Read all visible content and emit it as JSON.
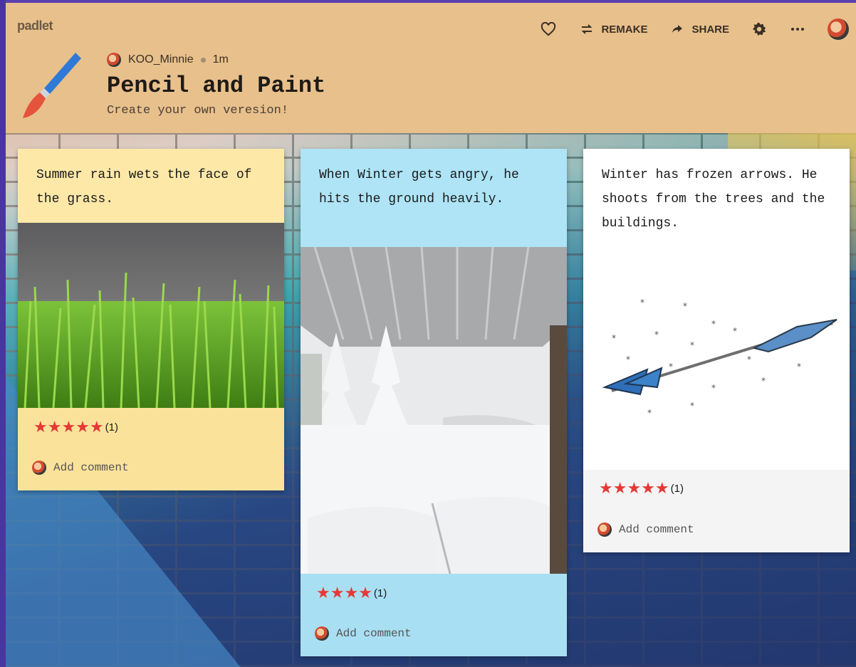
{
  "app": {
    "name": "padlet"
  },
  "toolbar": {
    "remake_label": "REMAKE",
    "share_label": "SHARE"
  },
  "board": {
    "author": "KOO_Minnie",
    "time": "1m",
    "title": "Pencil and Paint",
    "subtitle": "Create your own veresion!"
  },
  "posts": [
    {
      "text": "Summer rain wets the face of the grass.",
      "stars": "★★★★★",
      "rating_count": "(1)",
      "comment_label": "Add comment"
    },
    {
      "text": "When Winter gets angry, he hits the ground heavily.",
      "stars": "★★★★",
      "rating_count": "(1)",
      "comment_label": "Add comment"
    },
    {
      "text": "Winter has frozen arrows. He shoots from the trees and the buildings.",
      "stars": "★★★★★",
      "rating_count": "(1)",
      "comment_label": "Add comment"
    }
  ],
  "icons": [
    "heart-icon",
    "remake-icon",
    "share-icon",
    "gear-icon",
    "more-icon",
    "paintbrush-icon"
  ],
  "colors": {
    "header": "#e8c08c",
    "star": "#e53935",
    "card1": "#fde8a8",
    "card2": "#aee4f6",
    "card3": "#ffffff"
  }
}
